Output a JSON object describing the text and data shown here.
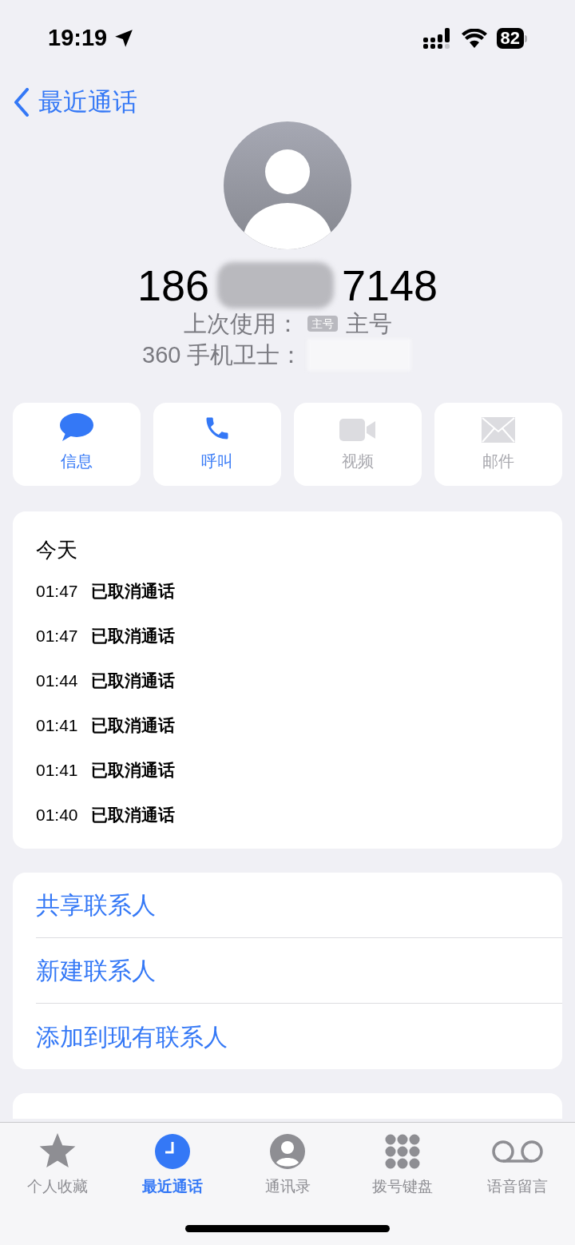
{
  "status_bar": {
    "time": "19:19",
    "battery": "82"
  },
  "nav": {
    "back": "最近通话"
  },
  "contact": {
    "number_start": "186",
    "number_end": "7148",
    "last_used_label": "上次使用：",
    "last_used_badge": "主号",
    "last_used_value": "主号",
    "security_label": "360 手机卫士："
  },
  "actions": [
    {
      "kind": "message",
      "label": "信息",
      "disabled": false
    },
    {
      "kind": "call",
      "label": "呼叫",
      "disabled": false
    },
    {
      "kind": "video",
      "label": "视频",
      "disabled": true
    },
    {
      "kind": "mail",
      "label": "邮件",
      "disabled": true
    }
  ],
  "history": {
    "day": "今天",
    "calls": [
      {
        "time": "01:47",
        "status": "已取消通话"
      },
      {
        "time": "01:47",
        "status": "已取消通话"
      },
      {
        "time": "01:44",
        "status": "已取消通话"
      },
      {
        "time": "01:41",
        "status": "已取消通话"
      },
      {
        "time": "01:41",
        "status": "已取消通话"
      },
      {
        "time": "01:40",
        "status": "已取消通话"
      }
    ]
  },
  "options": [
    "共享联系人",
    "新建联系人",
    "添加到现有联系人"
  ],
  "tab_bar": [
    {
      "kind": "favorites",
      "label": "个人收藏",
      "selected": false
    },
    {
      "kind": "recents",
      "label": "最近通话",
      "selected": true
    },
    {
      "kind": "contacts",
      "label": "通讯录",
      "selected": false
    },
    {
      "kind": "keypad",
      "label": "拨号键盘",
      "selected": false
    },
    {
      "kind": "voicemail",
      "label": "语音留言",
      "selected": false
    }
  ]
}
